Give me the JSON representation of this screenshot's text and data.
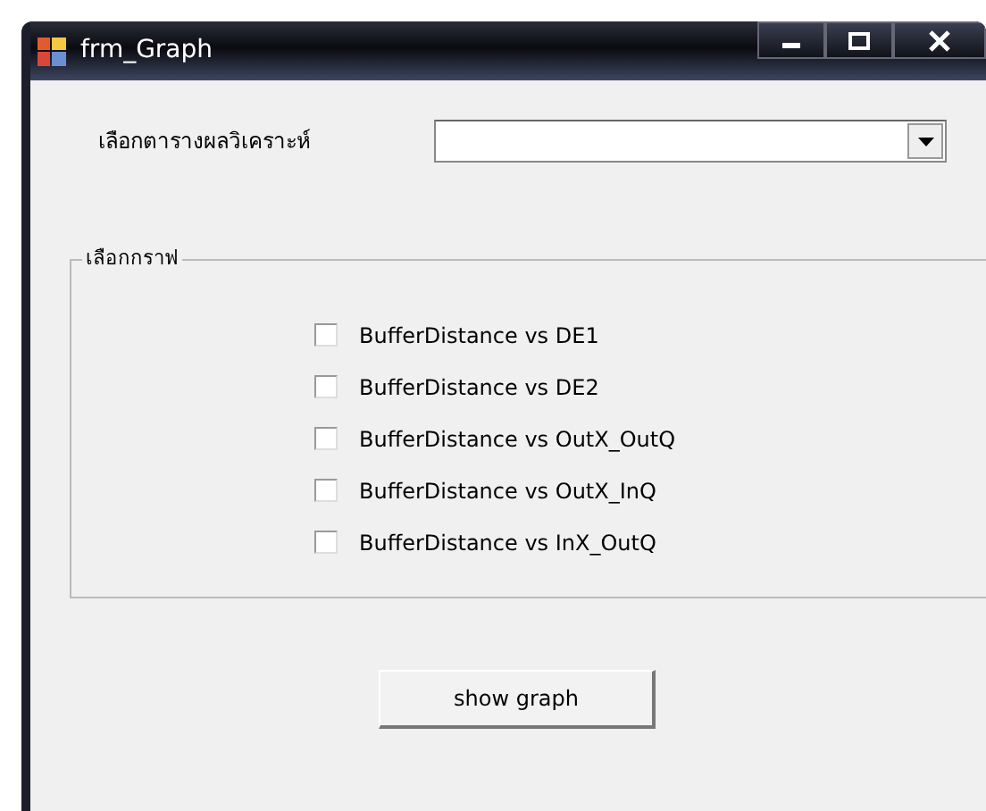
{
  "window": {
    "title": "frm_Graph"
  },
  "table_select": {
    "label": "เลือกตารางผลวิเคราะห์"
  },
  "graph_group": {
    "title": "เลือกกราฟ",
    "options": [
      {
        "label": "BufferDistance vs DE1",
        "checked": false
      },
      {
        "label": "BufferDistance vs DE2",
        "checked": false
      },
      {
        "label": "BufferDistance vs OutX_OutQ",
        "checked": false
      },
      {
        "label": "BufferDistance vs OutX_InQ",
        "checked": false
      },
      {
        "label": "BufferDistance vs InX_OutQ",
        "checked": false
      }
    ]
  },
  "buttons": [
    {
      "label": "show graph"
    }
  ]
}
